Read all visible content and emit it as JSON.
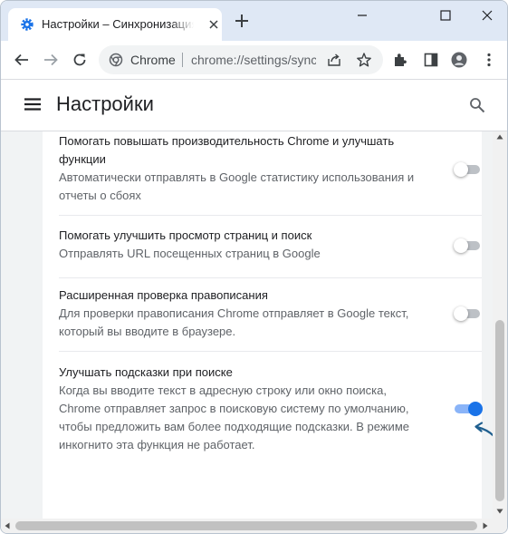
{
  "tab": {
    "title": "Настройки – Синхронизация сервисов Google",
    "favicon": "gear-icon"
  },
  "toolbar": {
    "site_label": "Chrome",
    "url": "chrome://settings/syncSetup"
  },
  "header": {
    "title": "Настройки"
  },
  "settings": [
    {
      "title": "Помогать повышать производительность Chrome и улучшать функции",
      "description": "Автоматически отправлять в Google статистику использования и отчеты о сбоях",
      "enabled": false
    },
    {
      "title": "Помогать улучшить просмотр страниц и поиск",
      "description": "Отправлять URL посещенных страниц в Google",
      "enabled": false
    },
    {
      "title": "Расширенная проверка правописания",
      "description": "Для проверки правописания Chrome отправляет в Google текст, который вы вводите в браузере.",
      "enabled": false
    },
    {
      "title": "Улучшать подсказки при поиске",
      "description": "Когда вы вводите текст в адресную строку или окно поиска, Chrome отправляет запрос в поисковую систему по умолчанию, чтобы предложить вам более подходящие подсказки. В режиме инкогнито эта функция не работает.",
      "enabled": true
    }
  ],
  "colors": {
    "accent": "#1a73e8",
    "accent_track": "#8ab4f8",
    "tab_strip": "#dfe8f5"
  }
}
